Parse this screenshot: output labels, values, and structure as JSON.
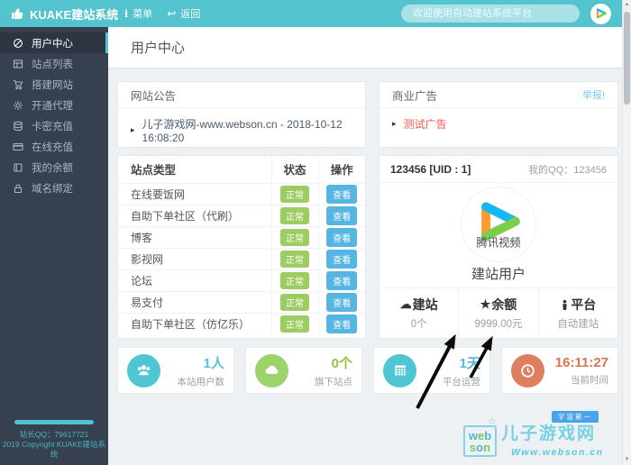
{
  "topbar": {
    "brand": "KUAKE建站系统",
    "menu_label": "菜单",
    "back_label": "返回",
    "search_placeholder": "欢迎使用自动建站系统平台"
  },
  "sidebar": {
    "items": [
      {
        "label": "用户中心",
        "icon": "dashboard-icon",
        "active": true
      },
      {
        "label": "站点列表",
        "icon": "site-list-icon"
      },
      {
        "label": "搭建网站",
        "icon": "cart-icon"
      },
      {
        "label": "开通代理",
        "icon": "gear-icon"
      },
      {
        "label": "卡密充值",
        "icon": "coins-icon"
      },
      {
        "label": "在线充值",
        "icon": "credit-card-icon"
      },
      {
        "label": "我的余额",
        "icon": "wallet-icon"
      },
      {
        "label": "域名绑定",
        "icon": "lock-icon"
      }
    ],
    "footer": {
      "qq": "站长QQ：79617721",
      "copyright": "2019 Copyright KUAKE建站系统"
    }
  },
  "page": {
    "title": "用户中心"
  },
  "notice": {
    "title": "网站公告",
    "item": "儿子游戏网-www.webson.cn - 2018-10-12 16:08:20"
  },
  "ad": {
    "title": "商业广告",
    "report_label": "举报!",
    "item": "测试广告"
  },
  "site_table": {
    "headers": [
      "站点类型",
      "状态",
      "操作"
    ],
    "rows": [
      {
        "name": "在线要饭网",
        "status": "正常",
        "action": "查看"
      },
      {
        "name": "自助下单社区（代刷）",
        "status": "正常",
        "action": "查看"
      },
      {
        "name": "博客",
        "status": "正常",
        "action": "查看"
      },
      {
        "name": "影视网",
        "status": "正常",
        "action": "查看"
      },
      {
        "name": "论坛",
        "status": "正常",
        "action": "查看"
      },
      {
        "name": "易支付",
        "status": "正常",
        "action": "查看"
      },
      {
        "name": "自助下单社区（仿亿乐）",
        "status": "正常",
        "action": "查看"
      }
    ]
  },
  "user_panel": {
    "uid_text": "123456 [UID : 1]",
    "qq_text": "我的QQ：123456",
    "avatar_brand": "腾讯视频",
    "role": "建站用户",
    "stats": [
      {
        "icon": "cloud-icon",
        "label": "建站",
        "value": "0个"
      },
      {
        "icon": "star-icon",
        "label": "余额",
        "value": "9999.00元"
      },
      {
        "icon": "person-icon",
        "label": "平台",
        "value": "自动建站"
      }
    ]
  },
  "cards": [
    {
      "icon": "users-icon",
      "value": "1人",
      "label": "本站用户数",
      "circle_color": "#4fc6d3",
      "value_color": "#4fc6d3"
    },
    {
      "icon": "cloud-icon",
      "value": "0个",
      "label": "旗下站点",
      "circle_color": "#9ed26a",
      "value_color": "#8cc63f"
    },
    {
      "icon": "calendar-icon",
      "value": "1天",
      "label": "平台运营",
      "circle_color": "#4fc6d3",
      "value_color": "#55b6e2"
    },
    {
      "icon": "clock-icon",
      "value": "16:11:27",
      "label": "当前时间",
      "circle_color": "#dd7e5e",
      "value_color": "#e0734f"
    }
  ],
  "watermark": {
    "badge": "宇宙第一",
    "logo_line1": "web",
    "logo_line2": "son",
    "title": "儿子游戏网",
    "url": "Www.webson.cn"
  },
  "colors": {
    "topbar": "#53c3ce",
    "sidebar": "#37404e",
    "sidebar_active": "#2d3542",
    "accent_teal": "#4fc6d3",
    "status_green": "#9ccc62",
    "action_blue": "#57b5e3",
    "ad_red": "#f0584f",
    "card_orange": "#dd7e5e"
  }
}
